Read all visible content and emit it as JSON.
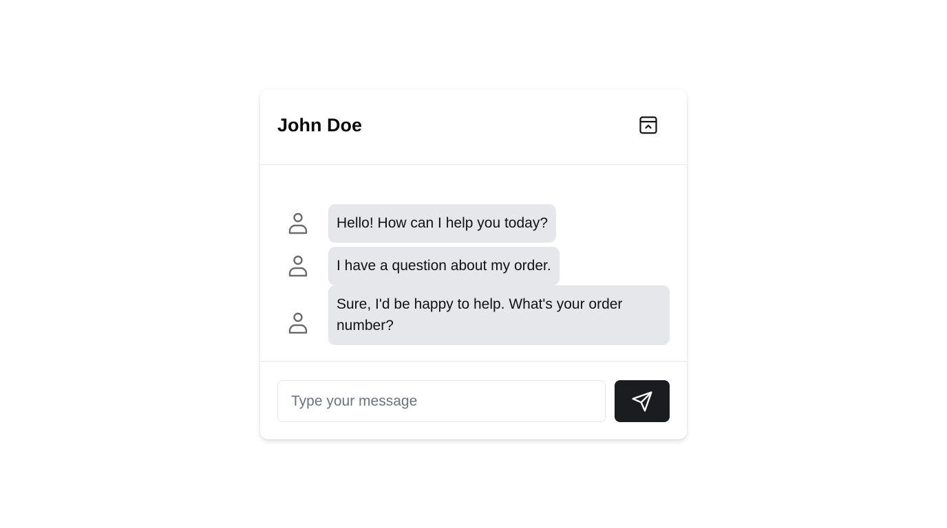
{
  "chat": {
    "contact_name": "John Doe",
    "header_icon": "panel-collapse-icon",
    "messages": [
      {
        "avatar_icon": "user-icon",
        "text": "Hello! How can I help you today?"
      },
      {
        "avatar_icon": "user-icon",
        "text": "I have a question about my order."
      },
      {
        "avatar_icon": "user-icon",
        "text": "Sure, I'd be happy to help. What's your order number?"
      }
    ],
    "composer": {
      "placeholder": "Type your message",
      "value": "",
      "send_icon": "send-icon"
    }
  },
  "colors": {
    "bubble_bg": "#e5e7eb",
    "send_button_bg": "#1b1c1f",
    "divider": "#e5e7eb",
    "icon_gray": "#6b6b6b"
  }
}
